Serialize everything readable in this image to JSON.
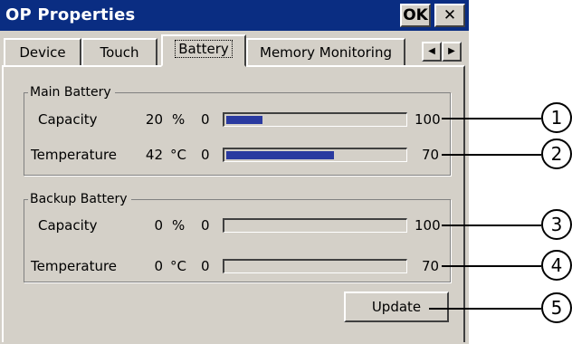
{
  "window": {
    "title": "OP Properties",
    "ok_label": "OK",
    "close_label": "✕"
  },
  "tabs": [
    {
      "label": "Device"
    },
    {
      "label": "Touch"
    },
    {
      "label": "Battery",
      "active": true
    },
    {
      "label": "Memory Monitoring"
    }
  ],
  "tab_scroll": {
    "left": "◀",
    "right": "▶"
  },
  "main_battery": {
    "title": "Main Battery",
    "capacity": {
      "label": "Capacity",
      "value": "20",
      "unit": "%",
      "min": "0",
      "max": "100",
      "level": 0.2
    },
    "temperature": {
      "label": "Temperature",
      "value": "42",
      "unit": "°C",
      "min": "0",
      "max": "70",
      "level": 0.6
    }
  },
  "backup_battery": {
    "title": "Backup Battery",
    "capacity": {
      "label": "Capacity",
      "value": "0",
      "unit": "%",
      "min": "0",
      "max": "100",
      "level": 0
    },
    "temperature": {
      "label": "Temperature",
      "value": "0",
      "unit": "°C",
      "min": "0",
      "max": "70",
      "level": 0
    }
  },
  "update_label": "Update",
  "callouts": [
    "1",
    "2",
    "3",
    "4",
    "5"
  ],
  "colors": {
    "titlebar": "#0a2d82",
    "bar_fill": "#2a3aa0",
    "face": "#d4d0c8"
  }
}
